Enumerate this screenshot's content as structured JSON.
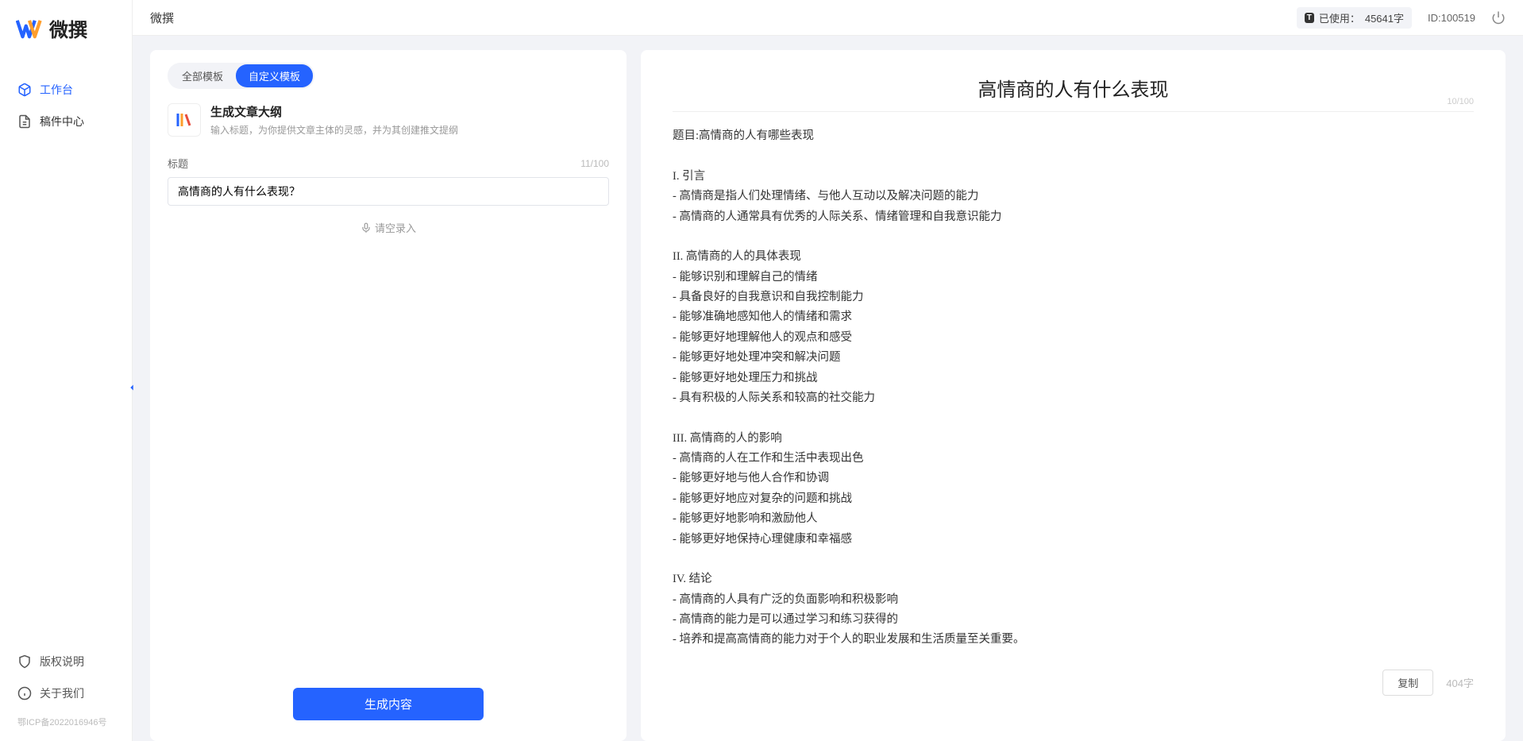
{
  "app": {
    "name": "微撰",
    "logo_text": "微撰"
  },
  "sidebar": {
    "items": [
      {
        "label": "工作台",
        "icon": "cube-icon",
        "active": true
      },
      {
        "label": "稿件中心",
        "icon": "document-icon",
        "active": false
      }
    ],
    "footer_items": [
      {
        "label": "版权说明",
        "icon": "shield-icon"
      },
      {
        "label": "关于我们",
        "icon": "info-icon"
      }
    ],
    "icp": "鄂ICP备2022016946号"
  },
  "topbar": {
    "title": "微撰",
    "usage_prefix": "已使用：",
    "usage_value": "45641字",
    "id_label": "ID:100519"
  },
  "left_panel": {
    "tabs": [
      {
        "label": "全部模板",
        "active": false
      },
      {
        "label": "自定义模板",
        "active": true
      }
    ],
    "template": {
      "title": "生成文章大纲",
      "desc": "输入标题，为你提供文章主体的灵感，并为其创建推文提纲"
    },
    "field_label": "标题",
    "char_count": "11/100",
    "input_value": "高情商的人有什么表现？",
    "voice_label": "请空录入",
    "generate_label": "生成内容"
  },
  "right_panel": {
    "title": "高情商的人有什么表现",
    "title_count": "10/100",
    "body": "题目:高情商的人有哪些表现\n\nI. 引言\n- 高情商是指人们处理情绪、与他人互动以及解决问题的能力\n- 高情商的人通常具有优秀的人际关系、情绪管理和自我意识能力\n\nII. 高情商的人的具体表现\n- 能够识别和理解自己的情绪\n- 具备良好的自我意识和自我控制能力\n- 能够准确地感知他人的情绪和需求\n- 能够更好地理解他人的观点和感受\n- 能够更好地处理冲突和解决问题\n- 能够更好地处理压力和挑战\n- 具有积极的人际关系和较高的社交能力\n\nIII. 高情商的人的影响\n- 高情商的人在工作和生活中表现出色\n- 能够更好地与他人合作和协调\n- 能够更好地应对复杂的问题和挑战\n- 能够更好地影响和激励他人\n- 能够更好地保持心理健康和幸福感\n\nIV. 结论\n- 高情商的人具有广泛的负面影响和积极影响\n- 高情商的能力是可以通过学习和练习获得的\n- 培养和提高高情商的能力对于个人的职业发展和生活质量至关重要。",
    "copy_label": "复制",
    "word_count": "404字"
  }
}
